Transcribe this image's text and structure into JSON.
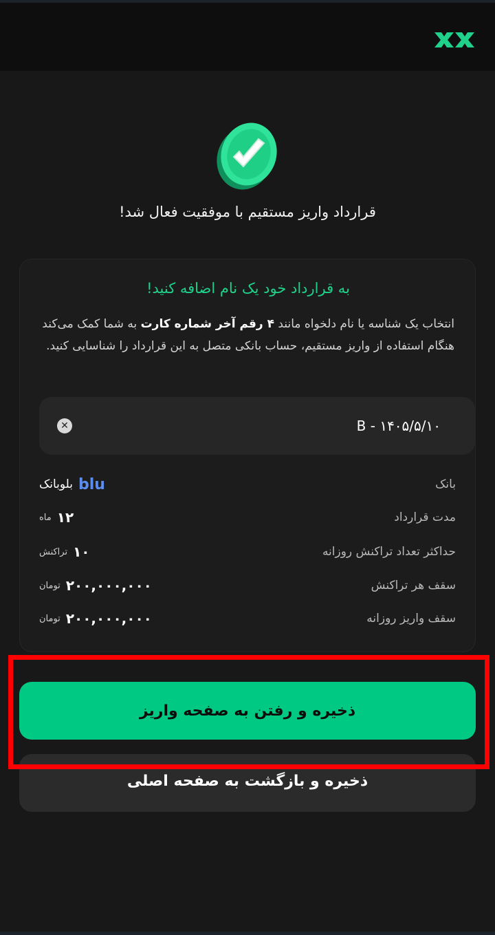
{
  "app": {
    "logo_icon": "xx-logo-icon",
    "accent_color": "#00c983"
  },
  "success": {
    "icon": "check-coin-icon",
    "title": "قرارداد واریز مستقیم با موفقیت فعال شد!"
  },
  "card": {
    "heading": "به قرارداد خود یک نام اضافه کنید!",
    "desc_part1": "انتخاب یک شناسه یا نام دلخواه مانند ",
    "desc_bold": "۴ رقم آخر شماره کارت",
    "desc_part2": " به شما کمک می‌کند هنگام استفاده از واریز مستقیم، حساب بانکی متصل به این قرارداد را شناسایی کنید.",
    "name_value": "B - ۱۴۰۵/۵/۱۰",
    "clear_icon": "close-icon",
    "rows": [
      {
        "label": "بانک",
        "value": "بلوبانک",
        "icon_text": "blu"
      },
      {
        "label": "مدت قرارداد",
        "value": "۱۲",
        "unit": "ماه"
      },
      {
        "label": "حداکثر تعداد تراکنش روزانه",
        "value": "۱۰",
        "unit": "تراکنش"
      },
      {
        "label": "سقف هر تراکنش",
        "value": "۲۰۰,۰۰۰,۰۰۰",
        "unit": "تومان"
      },
      {
        "label": "سقف واریز روزانه",
        "value": "۲۰۰,۰۰۰,۰۰۰",
        "unit": "تومان"
      }
    ]
  },
  "actions": {
    "primary_label": "ذخیره و رفتن به صفحه واریز",
    "secondary_label": "ذخیره و بازگشت به صفحه اصلی",
    "highlight_color": "#ff0000"
  }
}
